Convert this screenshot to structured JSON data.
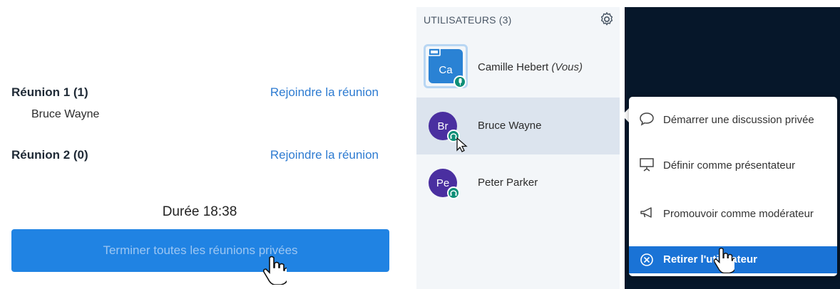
{
  "breakout": {
    "rooms": [
      {
        "title": "Réunion 1 (1)",
        "join_label": "Rejoindre la réunion",
        "members": [
          "Bruce Wayne"
        ]
      },
      {
        "title": "Réunion 2 (0)",
        "join_label": "Rejoindre la réunion",
        "members": []
      }
    ],
    "duration_label": "Durée 18:38",
    "end_all_label": "Terminer toutes les réunions privées"
  },
  "users_panel": {
    "header": "UTILISATEURS (3)",
    "users": [
      {
        "initials": "Ca",
        "name": "Camille Hebert",
        "suffix": "(Vous)",
        "role": "presenter"
      },
      {
        "initials": "Br",
        "name": "Bruce Wayne",
        "suffix": "",
        "role": "viewer"
      },
      {
        "initials": "Pe",
        "name": "Peter Parker",
        "suffix": "",
        "role": "viewer"
      }
    ]
  },
  "context_menu": {
    "items": [
      {
        "label": "Démarrer une discussion privée",
        "icon": "chat-bubble-icon"
      },
      {
        "label": "Définir comme présentateur",
        "icon": "presentation-screen-icon"
      },
      {
        "label": "Promouvoir comme modérateur",
        "icon": "megaphone-icon"
      },
      {
        "label": "Retirer l'utilisateur",
        "icon": "remove-circle-icon"
      }
    ]
  },
  "colors": {
    "accent": "#2083e3",
    "link": "#2d7bd1",
    "avatar": "#4a2fa0",
    "status": "#0e8f77",
    "dark_bg": "#06172a",
    "highlight": "#1a73d6"
  }
}
